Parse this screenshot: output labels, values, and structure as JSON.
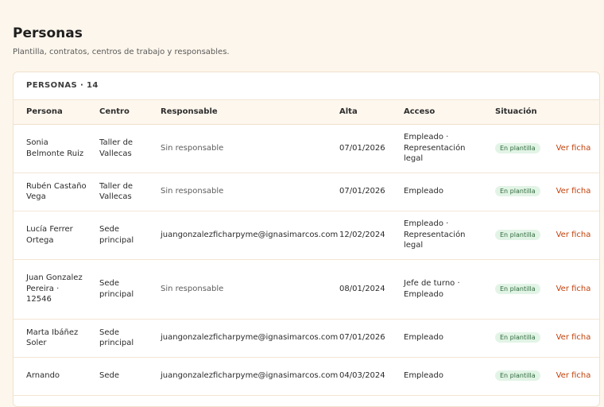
{
  "page": {
    "title": "Personas",
    "subtitle": "Plantilla, contratos, centros de trabajo y responsables."
  },
  "card": {
    "title": "PERSONAS · 14"
  },
  "table": {
    "columns": [
      "Persona",
      "Centro",
      "Responsable",
      "Alta",
      "Acceso",
      "Situación"
    ],
    "rows": [
      {
        "persona": "Sonia Belmonte Ruiz",
        "centro": "Taller de Vallecas",
        "responsable": "Sin responsable",
        "alta": "07/01/2026",
        "acceso": "Empleado · Representación legal",
        "situacion": "En plantilla",
        "action": "Ver ficha"
      },
      {
        "persona": "Rubén Castaño Vega",
        "centro": "Taller de Vallecas",
        "responsable": "Sin responsable",
        "alta": "07/01/2026",
        "acceso": "Empleado",
        "situacion": "En plantilla",
        "action": "Ver ficha"
      },
      {
        "persona": "Lucía Ferrer Ortega",
        "centro": "Sede principal",
        "responsable": "juangonzalezficharpyme@ignasimarcos.com",
        "alta": "12/02/2024",
        "acceso": "Empleado · Representación legal",
        "situacion": "En plantilla",
        "action": "Ver ficha"
      },
      {
        "persona": "Juan Gonzalez Pereira · 12546",
        "centro": "Sede principal",
        "responsable": "Sin responsable",
        "alta": "08/01/2024",
        "acceso": "Jefe de turno · Empleado",
        "situacion": "En plantilla",
        "action": "Ver ficha"
      },
      {
        "persona": "Marta Ibáñez Soler",
        "centro": "Sede principal",
        "responsable": "juangonzalezficharpyme@ignasimarcos.com",
        "alta": "07/01/2026",
        "acceso": "Empleado",
        "situacion": "En plantilla",
        "action": "Ver ficha"
      },
      {
        "persona": "Arnando",
        "centro": "Sede",
        "responsable": "juangonzalezficharpyme@ignasimarcos.com",
        "alta": "04/03/2024",
        "acceso": "Empleado",
        "situacion": "En plantilla",
        "action": "Ver ficha"
      }
    ]
  },
  "colors": {
    "background": "#fdf6ec",
    "accent": "#c2410c",
    "badge_bg": "#e2f4e6",
    "badge_text": "#2f6a3c"
  }
}
